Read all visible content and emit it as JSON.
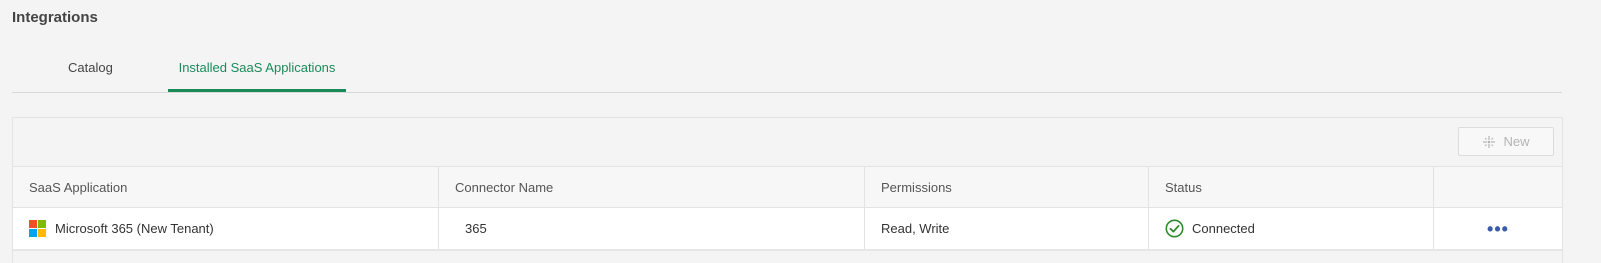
{
  "page": {
    "title": "Integrations"
  },
  "tabs": [
    {
      "label": "Catalog",
      "active": false
    },
    {
      "label": "Installed SaaS Applications",
      "active": true
    }
  ],
  "toolbar": {
    "new_label": "New",
    "new_icon": "sparkle-plus-icon"
  },
  "table": {
    "columns": [
      "SaaS Application",
      "Connector Name",
      "Permissions",
      "Status",
      ""
    ],
    "rows": [
      {
        "app": "Microsoft 365 (New Tenant)",
        "app_icon": "microsoft-logo-icon",
        "connector": "365",
        "permissions": "Read, Write",
        "status": "Connected",
        "status_icon": "check-circle-icon",
        "actions": "•••"
      }
    ]
  },
  "colors": {
    "accent": "#1b8a5a",
    "status_ok": "#2e8b2e",
    "actions": "#3b5aa8",
    "ms_red": "#f25022",
    "ms_green": "#7fba00",
    "ms_blue": "#00a4ef",
    "ms_yellow": "#ffb900"
  }
}
